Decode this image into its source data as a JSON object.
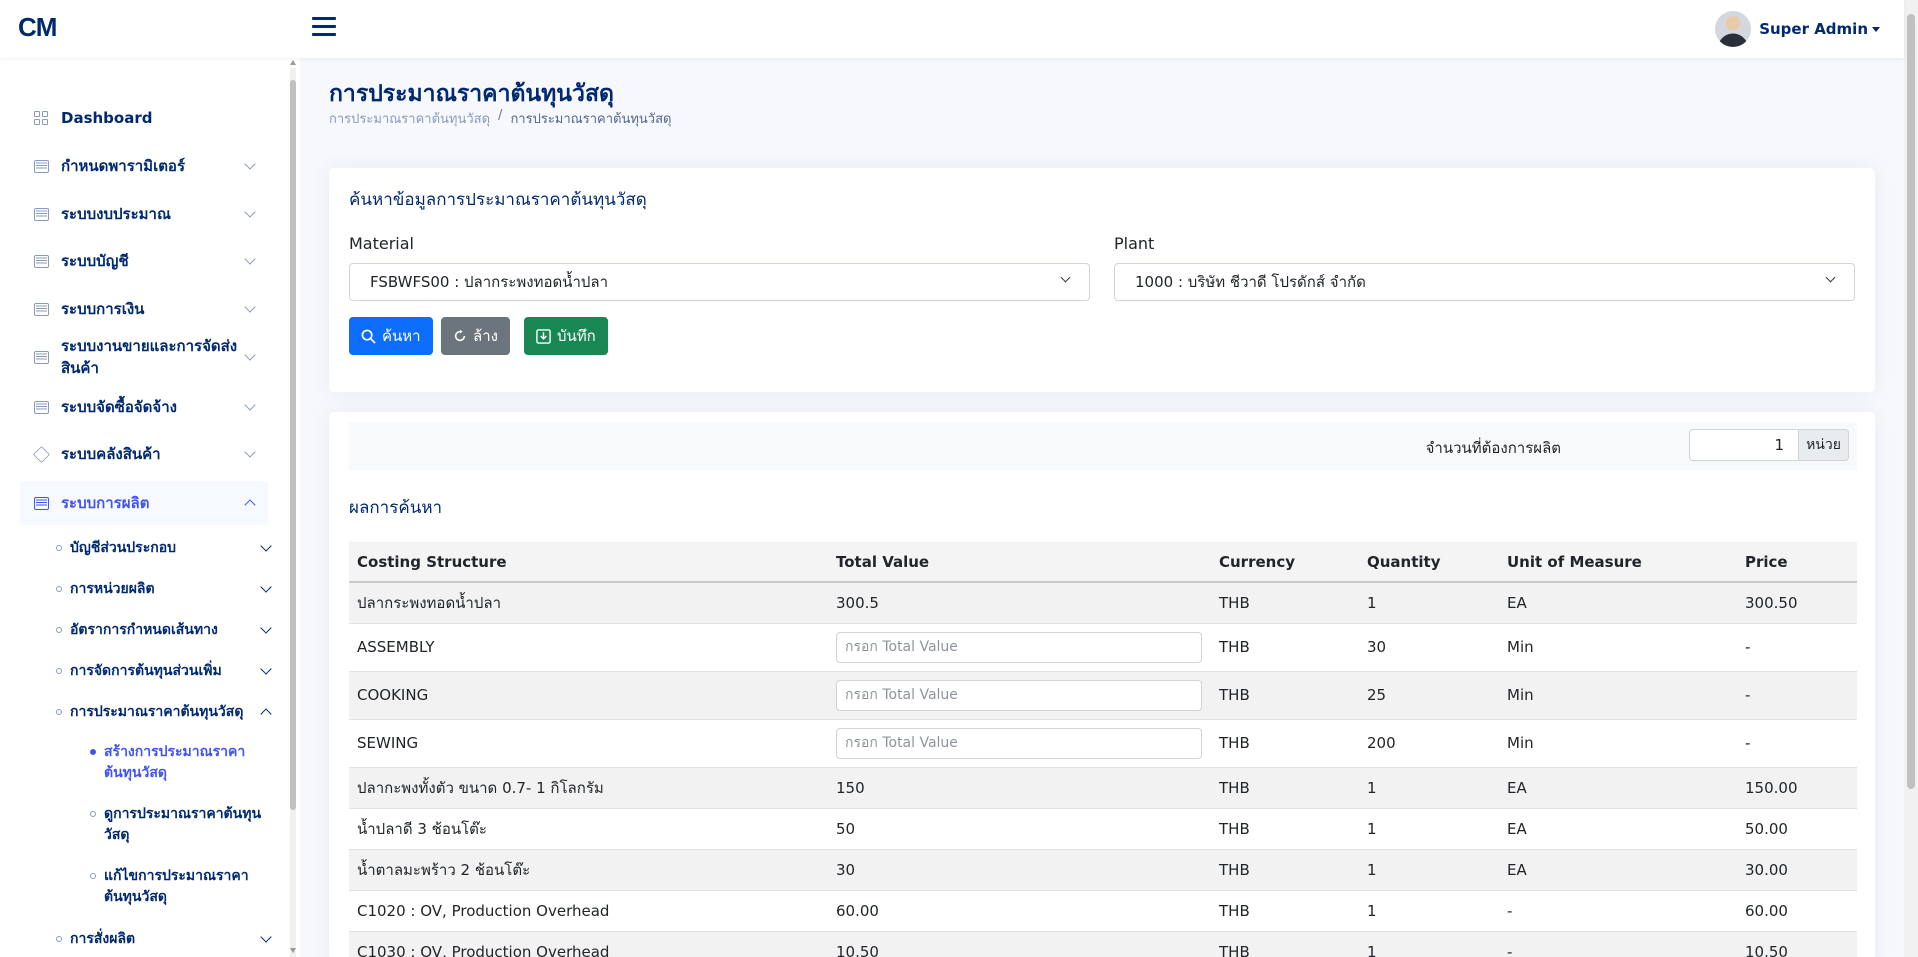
{
  "header": {
    "logo": "CM",
    "user_name": "Super Admin"
  },
  "sidebar": {
    "items": [
      {
        "label": "Dashboard"
      },
      {
        "label": "กำหนดพารามิเตอร์"
      },
      {
        "label": "ระบบงบประมาณ"
      },
      {
        "label": "ระบบบัญชี"
      },
      {
        "label": "ระบบการเงิน"
      },
      {
        "label": "ระบบงานขายและการจัดส่งสินค้า"
      },
      {
        "label": "ระบบจัดซื้อจัดจ้าง"
      },
      {
        "label": "ระบบคลังสินค้า"
      },
      {
        "label": "ระบบการผลิต"
      }
    ],
    "sub_items": [
      {
        "label": "บัญชีส่วนประกอบ"
      },
      {
        "label": "การหน่วยผลิต"
      },
      {
        "label": "อัตราการกำหนดเส้นทาง"
      },
      {
        "label": "การจัดการต้นทุนส่วนเพิ่ม"
      },
      {
        "label": "การประมาณราคาต้นทุนวัสดุ"
      }
    ],
    "subsub_items": [
      {
        "label": "สร้างการประมาณราคาต้นทุนวัสดุ"
      },
      {
        "label": "ดูการประมาณราคาต้นทุนวัสดุ"
      },
      {
        "label": "แก้ไขการประมาณราคาต้นทุนวัสดุ"
      }
    ],
    "last_sub_item": {
      "label": "การสั่งผลิต"
    }
  },
  "page": {
    "title": "การประมาณราคาต้นทุนวัสดุ",
    "breadcrumb": [
      "การประมาณราคาต้นทุนวัสดุ",
      "การประมาณราคาต้นทุนวัสดุ"
    ],
    "breadcrumb_sep": "/"
  },
  "search": {
    "title": "ค้นหาข้อมูลการประมาณราคาต้นทุนวัสดุ",
    "material_label": "Material",
    "material_value": "FSBWFS00 : ปลากระพงทอดน้ำปลา",
    "plant_label": "Plant",
    "plant_value": "1000 : บริษัท ชีวาดี โปรดักส์ จำกัด",
    "search_button": "ค้นหา",
    "clear_button": "ล้าง",
    "save_button": "บันทึก"
  },
  "results": {
    "qty_label": "จำนวนที่ต้องการผลิต",
    "qty_value": "1",
    "qty_unit": "หน่วย",
    "title": "ผลการค้นหา",
    "columns": [
      "Costing Structure",
      "Total Value",
      "Currency",
      "Quantity",
      "Unit of Measure",
      "Price"
    ],
    "placeholder": "กรอก Total Value",
    "rows": [
      {
        "costing": "ปลากระพงทอดน้ำปลา",
        "total": "300.5",
        "currency": "THB",
        "qty": "1",
        "uom": "EA",
        "price": "300.50"
      },
      {
        "costing": "ASSEMBLY",
        "total": "",
        "currency": "THB",
        "qty": "30",
        "uom": "Min",
        "price": "-"
      },
      {
        "costing": "COOKING",
        "total": "",
        "currency": "THB",
        "qty": "25",
        "uom": "Min",
        "price": "-"
      },
      {
        "costing": "SEWING",
        "total": "",
        "currency": "THB",
        "qty": "200",
        "uom": "Min",
        "price": "-"
      },
      {
        "costing": "ปลากะพงทั้งตัว ขนาด 0.7- 1 กิโลกรัม",
        "total": "150",
        "currency": "THB",
        "qty": "1",
        "uom": "EA",
        "price": "150.00"
      },
      {
        "costing": "น้ำปลาดี 3 ช้อนโต๊ะ",
        "total": "50",
        "currency": "THB",
        "qty": "1",
        "uom": "EA",
        "price": "50.00"
      },
      {
        "costing": "น้ำตาลมะพร้าว 2 ช้อนโต๊ะ",
        "total": "30",
        "currency": "THB",
        "qty": "1",
        "uom": "EA",
        "price": "30.00"
      },
      {
        "costing": "C1020 : OV, Production Overhead",
        "total": "60.00",
        "currency": "THB",
        "qty": "1",
        "uom": "-",
        "price": "60.00"
      },
      {
        "costing": "C1030 : OV, Production Overhead",
        "total": "10.50",
        "currency": "THB",
        "qty": "1",
        "uom": "-",
        "price": "10.50"
      }
    ]
  },
  "colors": {
    "brand": "#012970",
    "accent": "#4154f1",
    "primary": "#0d6efd",
    "secondary": "#6c757d",
    "success": "#198754"
  }
}
